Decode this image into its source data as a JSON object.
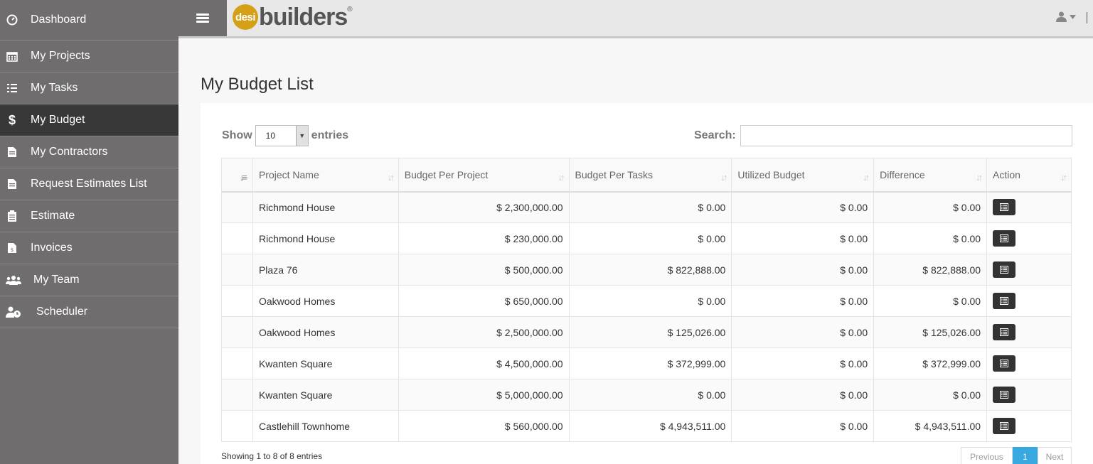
{
  "sidebar": {
    "items": [
      {
        "label": "Dashboard",
        "icon": "dashboard-icon"
      },
      {
        "label": "My Projects",
        "icon": "calendar-icon"
      },
      {
        "label": "My Tasks",
        "icon": "tasks-list-icon"
      },
      {
        "label": "My Budget",
        "icon": "dollar-icon"
      },
      {
        "label": "My Contractors",
        "icon": "document-icon"
      },
      {
        "label": "Request Estimates List",
        "icon": "document-icon"
      },
      {
        "label": "Estimate",
        "icon": "clipboard-icon"
      },
      {
        "label": "Invoices",
        "icon": "invoice-icon"
      },
      {
        "label": "My Team",
        "icon": "users-icon"
      },
      {
        "label": "Scheduler",
        "icon": "user-clock-icon"
      }
    ]
  },
  "header": {
    "logo_badge": "desi",
    "logo_text": "builders",
    "logo_reg": "®"
  },
  "page": {
    "title": "My Budget List"
  },
  "controls": {
    "show_label": "Show",
    "entries_value": "10",
    "entries_label": "entries",
    "search_label": "Search:",
    "search_value": ""
  },
  "table": {
    "columns": [
      "Project Name",
      "Budget Per Project",
      "Budget Per Tasks",
      "Utilized Budget",
      "Difference",
      "Action"
    ],
    "rows": [
      [
        "Richmond House",
        "$ 2,300,000.00",
        "$ 0.00",
        "$ 0.00",
        "$ 0.00"
      ],
      [
        "Richmond House",
        "$ 230,000.00",
        "$ 0.00",
        "$ 0.00",
        "$ 0.00"
      ],
      [
        "Plaza 76",
        "$ 500,000.00",
        "$ 822,888.00",
        "$ 0.00",
        "$ 822,888.00"
      ],
      [
        "Oakwood Homes",
        "$ 650,000.00",
        "$ 0.00",
        "$ 0.00",
        "$ 0.00"
      ],
      [
        "Oakwood Homes",
        "$ 2,500,000.00",
        "$ 125,026.00",
        "$ 0.00",
        "$ 125,026.00"
      ],
      [
        "Kwanten Square",
        "$ 4,500,000.00",
        "$ 372,999.00",
        "$ 0.00",
        "$ 372,999.00"
      ],
      [
        "Kwanten Square",
        "$ 5,000,000.00",
        "$ 0.00",
        "$ 0.00",
        "$ 0.00"
      ],
      [
        "Castlehill Townhome",
        "$ 560,000.00",
        "$ 4,943,511.00",
        "$ 0.00",
        "$ 4,943,511.00"
      ]
    ]
  },
  "footer": {
    "info": "Showing 1 to 8 of 8 entries",
    "prev": "Previous",
    "current_page": "1",
    "next": "Next"
  }
}
